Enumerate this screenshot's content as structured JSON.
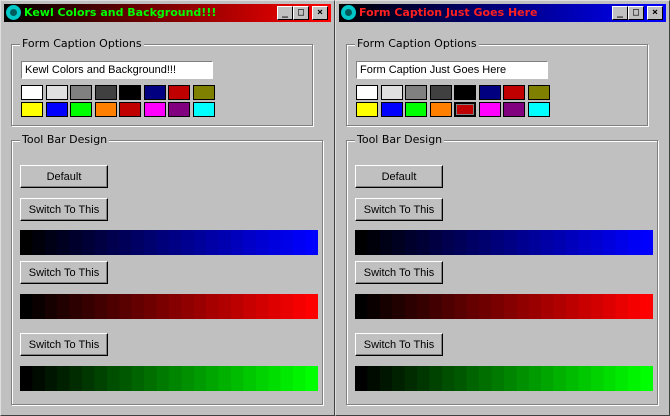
{
  "windows": [
    {
      "title": "Kewl Colors and Background!!!",
      "title_color": "#00ff00",
      "caption_group_title": "Form Caption Options",
      "caption_value": "Kewl Colors and Background!!!",
      "toolbar_group_title": "Tool Bar Design",
      "default_label": "Default",
      "switch_label": "Switch To This"
    },
    {
      "title": "Form Caption Just Goes Here",
      "title_color": "#ff2020",
      "caption_group_title": "Form Caption Options",
      "caption_value": "Form Caption Just Goes Here",
      "toolbar_group_title": "Tool Bar Design",
      "default_label": "Default",
      "switch_label": "Switch To This"
    }
  ],
  "palette": [
    "#ffffff",
    "#e0e0e0",
    "#808080",
    "#404040",
    "#000000",
    "#000080",
    "#c00000",
    "#808000",
    "#ffff00",
    "#0000ff",
    "#00ff00",
    "#ff8000",
    "#c00000",
    "#ff00ff",
    "#800080",
    "#00ffff"
  ],
  "selected_swatch_win2": 12,
  "gradients": {
    "blue": "#0000ff",
    "red": "#ff0000",
    "green": "#00ff00"
  },
  "caption_buttons": {
    "minimize": "_",
    "maximize": "□",
    "close": "×"
  }
}
